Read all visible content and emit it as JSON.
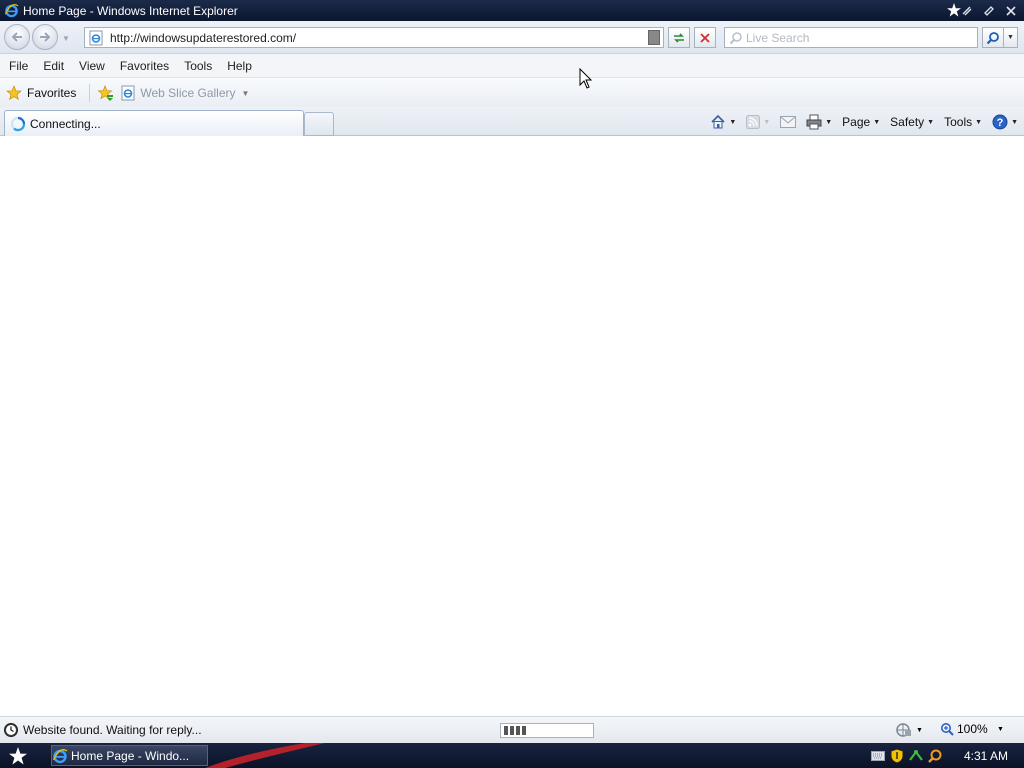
{
  "window": {
    "title": "Home Page - Windows Internet Explorer"
  },
  "address_bar": {
    "url": "http://windowsupdaterestored.com/"
  },
  "search": {
    "placeholder": "Live Search"
  },
  "menu": {
    "items": [
      "File",
      "Edit",
      "View",
      "Favorites",
      "Tools",
      "Help"
    ]
  },
  "favorites_bar": {
    "favorites_label": "Favorites",
    "web_slice_gallery_label": "Web Slice Gallery"
  },
  "tabs": {
    "active_label": "Connecting..."
  },
  "command_bar": {
    "page_label": "Page",
    "safety_label": "Safety",
    "tools_label": "Tools"
  },
  "status_bar": {
    "text": "Website found. Waiting for reply...",
    "progress_blocks": 4,
    "zoom": "100%"
  },
  "taskbar": {
    "task_label": "Home Page - Windo...",
    "clock": "4:31 AM"
  },
  "colors": {
    "titlebar": "#0b1730",
    "taskbar": "#0a1226",
    "accent": "#1c6fd6"
  }
}
